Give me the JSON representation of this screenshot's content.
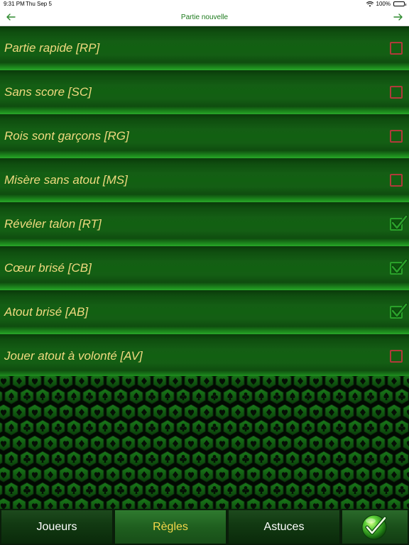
{
  "status_bar": {
    "time": "9:31 PM",
    "date": "Thu Sep 5",
    "battery": "100%"
  },
  "nav": {
    "title": "Partie nouvelle",
    "back_icon": "arrow-left-icon",
    "forward_icon": "arrow-right-icon"
  },
  "rules": [
    {
      "label": "Partie rapide [RP]",
      "checked": false
    },
    {
      "label": "Sans score [SC]",
      "checked": false
    },
    {
      "label": "Rois sont garçons [RG]",
      "checked": false
    },
    {
      "label": "Misère sans atout [MS]",
      "checked": false
    },
    {
      "label": "Révéler talon [RT]",
      "checked": true
    },
    {
      "label": "Cœur brisé [CB]",
      "checked": true
    },
    {
      "label": "Atout brisé [AB]",
      "checked": true
    },
    {
      "label": "Jouer atout à volonté [AV]",
      "checked": false
    }
  ],
  "tabs": [
    {
      "label": "Joueurs",
      "active": false
    },
    {
      "label": "Règles",
      "active": true
    },
    {
      "label": "Astuces",
      "active": false
    }
  ],
  "confirm_icon": "checkmark-ball-icon",
  "colors": {
    "nav_title": "#1c7a1c",
    "rule_label": "#f0d980",
    "active_tab": "#f5d84a",
    "unchecked_border": "#b03a3a",
    "check": "#2aa02a"
  }
}
